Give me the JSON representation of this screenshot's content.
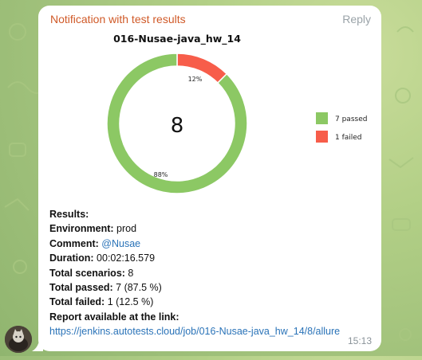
{
  "message": {
    "sender": "Notification with test results",
    "reply_label": "Reply",
    "time": "15:13"
  },
  "chart_data": {
    "type": "pie",
    "title": "016-Nusae-java_hw_14",
    "center_label": "8",
    "categories": [
      "passed",
      "failed"
    ],
    "values": [
      7,
      1
    ],
    "percent_labels": [
      "88%",
      "12%"
    ],
    "legend": [
      "7 passed",
      "1 failed"
    ],
    "colors": [
      "#8cc864",
      "#f75d4a"
    ],
    "legend_placement": "right"
  },
  "results": {
    "heading": "Results:",
    "environment_label": "Environment:",
    "environment_value": "prod",
    "comment_label": "Comment:",
    "comment_value": "@Nusae",
    "duration_label": "Duration:",
    "duration_value": "00:02:16.579",
    "total_scenarios_label": "Total scenarios:",
    "total_scenarios_value": "8",
    "total_passed_label": "Total passed:",
    "total_passed_value": "7 (87.5 %)",
    "total_failed_label": "Total failed:",
    "total_failed_value": "1 (12.5 %)",
    "report_label": "Report available at the link:",
    "report_url": "https://jenkins.autotests.cloud/job/016-Nusae-java_hw_14/8/allure"
  }
}
